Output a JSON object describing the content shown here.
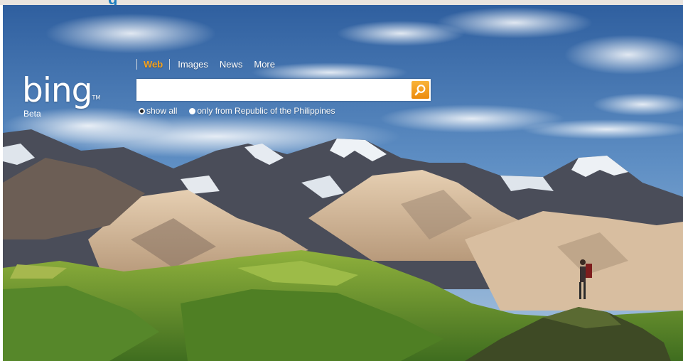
{
  "browser": {
    "partial_logo_text": "g"
  },
  "brand": {
    "logo_text": "bing",
    "trademark": "TM",
    "beta_label": "Beta"
  },
  "nav": {
    "items": [
      {
        "label": "Web",
        "active": true
      },
      {
        "label": "Images",
        "active": false
      },
      {
        "label": "News",
        "active": false
      },
      {
        "label": "More",
        "active": false
      }
    ]
  },
  "search": {
    "value": "",
    "placeholder": "",
    "button_icon": "magnifier-icon"
  },
  "scope": {
    "options": [
      {
        "label": "show all",
        "checked": true
      },
      {
        "label": "only from Republic of the Philippines",
        "checked": false
      }
    ]
  },
  "background": {
    "description_icon": "mountain-landscape-photo"
  },
  "colors": {
    "active_nav": "#f7a21b",
    "search_button": "#ec8a0c",
    "sky": "#3f6fae"
  }
}
